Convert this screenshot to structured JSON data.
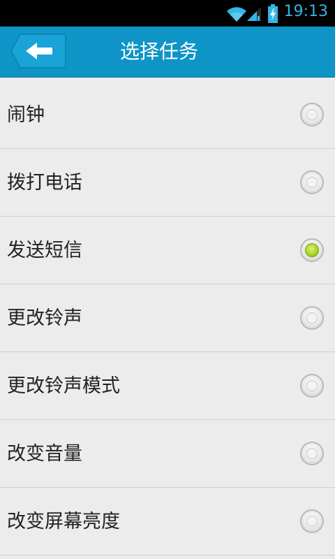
{
  "status_bar": {
    "time": "19:13",
    "icons": [
      "wifi-icon",
      "signal-icon",
      "battery-charging-icon"
    ]
  },
  "app_bar": {
    "title": "选择任务",
    "back_icon": "back-arrow-icon"
  },
  "colors": {
    "app_bar": "#0f94c7",
    "status_time": "#33b5e5",
    "radio_selected": "#a6d12a",
    "background": "#ececec"
  },
  "tasks": [
    {
      "label": "闹钟",
      "selected": false
    },
    {
      "label": "拨打电话",
      "selected": false
    },
    {
      "label": "发送短信",
      "selected": true
    },
    {
      "label": "更改铃声",
      "selected": false
    },
    {
      "label": "更改铃声模式",
      "selected": false
    },
    {
      "label": "改变音量",
      "selected": false
    },
    {
      "label": "改变屏幕亮度",
      "selected": false
    }
  ]
}
